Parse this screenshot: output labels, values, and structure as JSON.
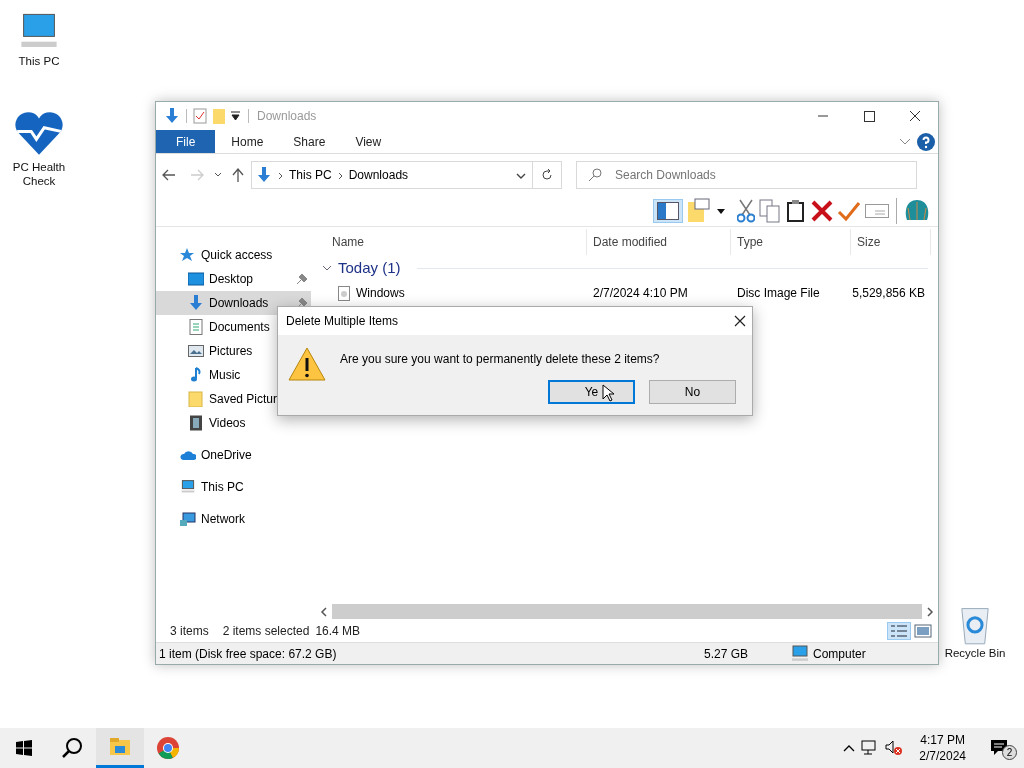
{
  "desktop_icons": [
    {
      "label": "This PC",
      "kind": "pc"
    },
    {
      "label": "PC Health Check",
      "kind": "health"
    },
    {
      "label": "Recycle Bin",
      "kind": "recycle"
    }
  ],
  "window": {
    "title": "Downloads",
    "ribbon_tabs": [
      {
        "label": "File",
        "selected": true
      },
      {
        "label": "Home",
        "selected": false
      },
      {
        "label": "Share",
        "selected": false
      },
      {
        "label": "View",
        "selected": false
      }
    ],
    "address": {
      "crumbs": [
        "This PC",
        "Downloads"
      ]
    },
    "search": {
      "placeholder": "Search Downloads"
    },
    "nav": [
      {
        "label": "Quick access",
        "kind": "star",
        "children": [
          {
            "label": "Desktop",
            "kind": "desktop",
            "pinned": true,
            "selected": false
          },
          {
            "label": "Downloads",
            "kind": "download",
            "pinned": true,
            "selected": true
          },
          {
            "label": "Documents",
            "kind": "document",
            "selected": false
          },
          {
            "label": "Pictures",
            "kind": "picture",
            "selected": false
          },
          {
            "label": "Music",
            "kind": "music",
            "selected": false
          },
          {
            "label": "Saved Pictur",
            "kind": "folder",
            "selected": false
          },
          {
            "label": "Videos",
            "kind": "video",
            "selected": false
          }
        ]
      },
      {
        "label": "OneDrive",
        "kind": "cloud"
      },
      {
        "label": "This PC",
        "kind": "pc"
      },
      {
        "label": "Network",
        "kind": "network"
      }
    ],
    "columns": [
      "Name",
      "Date modified",
      "Type",
      "Size"
    ],
    "groups": [
      {
        "label": "Today (1)",
        "expanded": true,
        "rows": [
          {
            "cells": [
              "Windows",
              "2/7/2024 4:10 PM",
              "Disc Image File",
              "5,529,856 KB"
            ]
          }
        ]
      }
    ],
    "status": {
      "count": "3 items",
      "selection": "2 items selected",
      "size": "16.4 MB"
    },
    "details_bar": {
      "info": "1 item (Disk free space: 67.2 GB)",
      "size": "5.27 GB",
      "location": "Computer"
    }
  },
  "dialog": {
    "title": "Delete Multiple Items",
    "message": "Are you sure you want to permanently delete these 2 items?",
    "buttons": [
      {
        "label": "Ye",
        "default": true
      },
      {
        "label": "No",
        "default": false
      }
    ]
  },
  "taskbar": {
    "apps": [
      {
        "kind": "explorer",
        "running": true
      },
      {
        "kind": "chrome",
        "running": false
      }
    ],
    "time": "4:17 PM",
    "date": "2/7/2024",
    "notifications": "2"
  }
}
